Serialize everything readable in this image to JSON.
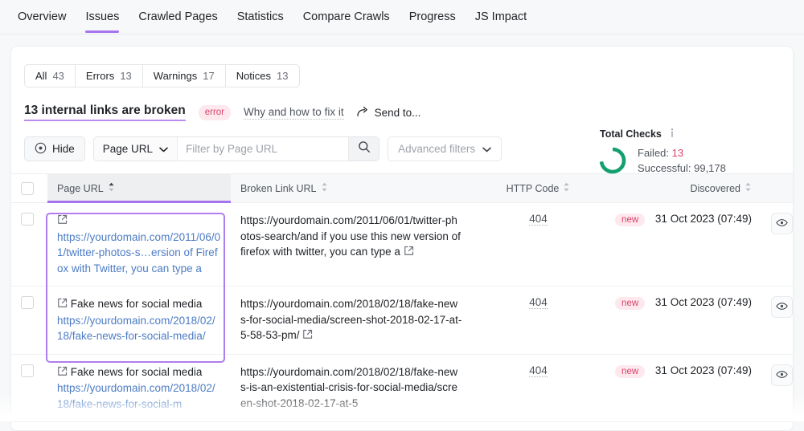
{
  "nav": {
    "items": [
      {
        "label": "Overview",
        "active": false
      },
      {
        "label": "Issues",
        "active": true
      },
      {
        "label": "Crawled Pages",
        "active": false
      },
      {
        "label": "Statistics",
        "active": false
      },
      {
        "label": "Compare Crawls",
        "active": false
      },
      {
        "label": "Progress",
        "active": false
      },
      {
        "label": "JS Impact",
        "active": false
      }
    ]
  },
  "segments": [
    {
      "label": "All",
      "count": "43"
    },
    {
      "label": "Errors",
      "count": "13"
    },
    {
      "label": "Warnings",
      "count": "17"
    },
    {
      "label": "Notices",
      "count": "13"
    }
  ],
  "issue": {
    "title": "13 internal links are broken",
    "severity_badge": "error",
    "why_link": "Why and how to fix it",
    "send_to": "Send to..."
  },
  "toolbar": {
    "hide_label": "Hide",
    "filter_field": "Page URL",
    "filter_placeholder": "Filter by Page URL",
    "filter_value": "",
    "advanced_filters": "Advanced filters"
  },
  "total_checks": {
    "title": "Total Checks",
    "failed_label": "Failed:",
    "failed_value": "13",
    "successful_label": "Successful:",
    "successful_value": "99,178",
    "ring_color": "#14a06e"
  },
  "table": {
    "headers": {
      "page_url": "Page URL",
      "broken_link_url": "Broken Link URL",
      "http_code": "HTTP Code",
      "discovered": "Discovered"
    },
    "rows": [
      {
        "page_title": "",
        "page_url": "https://yourdomain.com/2011/06/01/twitter-photos-s…ersion of Firefox with Twitter, you can type a",
        "broken_link_url": "https://yourdomain.com/2011/06/01/twitter-photos-search/and if you use this new version of firefox with twitter, you can type a",
        "http_code": "404",
        "status_badge": "new",
        "discovered": "31 Oct 2023 (07:49)"
      },
      {
        "page_title": "Fake news for social media",
        "page_url": "https://yourdomain.com/2018/02/18/fake-news-for-social-media/",
        "broken_link_url": "https://yourdomain.com/2018/02/18/fake-news-for-social-media/screen-shot-2018-02-17-at-5-58-53-pm/",
        "http_code": "404",
        "status_badge": "new",
        "discovered": "31 Oct 2023 (07:49)"
      },
      {
        "page_title": "Fake news for social media",
        "page_url": "https://yourdomain.com/2018/02/18/fake-news-for-social-m",
        "broken_link_url": "https://yourdomain.com/2018/02/18/fake-news-is-an-existential-crisis-for-social-media/screen-shot-2018-02-17-at-5",
        "http_code": "404",
        "status_badge": "new",
        "discovered": "31 Oct 2023 (07:49)"
      }
    ]
  }
}
